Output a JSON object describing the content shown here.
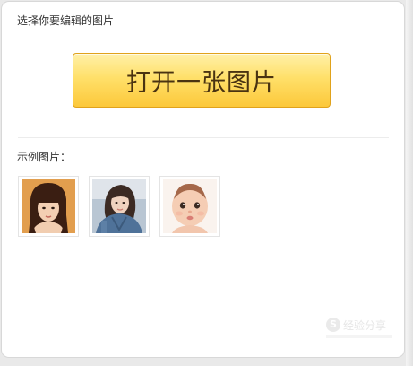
{
  "header": {
    "instruction": "选择你要编辑的图片"
  },
  "open_button": {
    "label": "打开一张图片"
  },
  "samples": {
    "label": "示例图片：",
    "items": [
      {
        "icon": "girl-portrait-photo"
      },
      {
        "icon": "woman-selfie-photo"
      },
      {
        "icon": "baby-portrait-photo"
      }
    ]
  },
  "watermark": {
    "logo": "S",
    "text": "经验分享"
  },
  "colors": {
    "button_top": "#fff0a8",
    "button_bottom": "#fcc83a",
    "button_border": "#e0a21c",
    "button_text": "#4a3311"
  }
}
